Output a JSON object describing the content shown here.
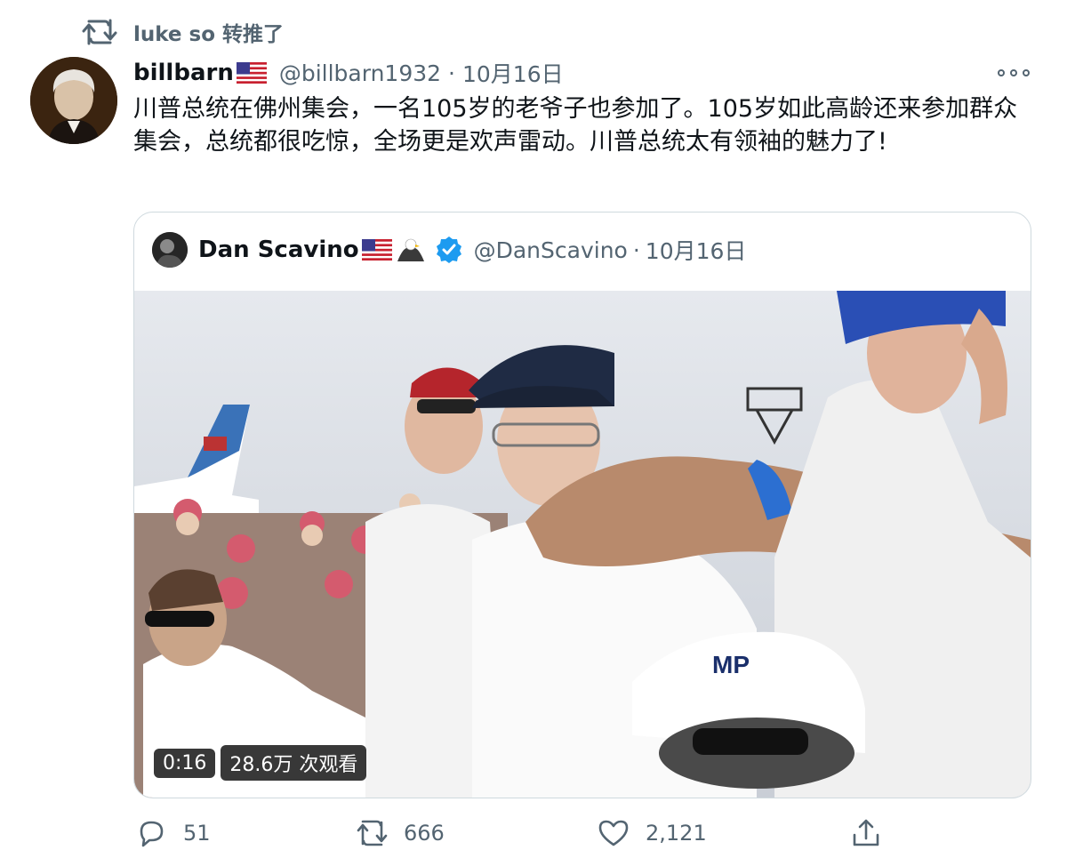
{
  "retweet": {
    "text": "luke so 转推了",
    "icon": "retweet-icon"
  },
  "author": {
    "name": "billbarn",
    "flag": "🇺🇸",
    "handle": "@billbarn1932",
    "separator": "·",
    "date": "10月16日",
    "avatar_icon": "portrait-avatar"
  },
  "more_menu": {
    "icon": "more-icon"
  },
  "tweet_text": "川普总统在佛州集会，一名105岁的老爷子也参加了。105岁如此高龄还来参加群众集会，总统都很吃惊，全场更是欢声雷动。川普总统太有领袖的魅力了!",
  "quote": {
    "name": "Dan Scavino",
    "flag": "🇺🇸",
    "eagle": "🦅",
    "verified_icon": "verified-badge-icon",
    "handle": "@DanScavino",
    "separator": "·",
    "date": "10月16日",
    "video": {
      "duration": "0:16",
      "views": "28.6万 次观看",
      "icon": "video-thumbnail"
    }
  },
  "actions": {
    "reply": {
      "count": "51",
      "icon": "reply-icon"
    },
    "retweet": {
      "count": "666",
      "icon": "retweet-icon"
    },
    "like": {
      "count": "2,121",
      "icon": "heart-icon"
    },
    "share": {
      "icon": "share-icon"
    }
  },
  "colors": {
    "text": "#0f1419",
    "secondary": "#536471",
    "border": "#cfd9de",
    "verified": "#1d9bf0"
  }
}
